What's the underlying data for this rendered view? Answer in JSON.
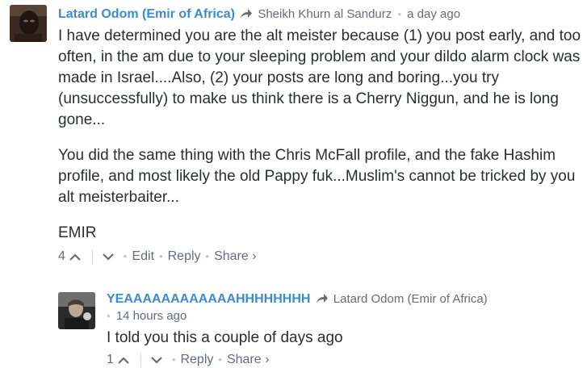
{
  "comments": [
    {
      "author": "Latard Odom (Emir of Africa)",
      "reply_to": "Sheikh Khurn al Sandurz",
      "separator": "•",
      "time": "a day ago",
      "paragraphs": [
        "I have determined you are the alt meister because (1) you post early, and too often, in the am due to your sleeping problem and your dildo alarm clock was made in Israel....Also, (2) your posts are long and boring...you try (unsuccessfully) to make us think there is a Cherry Niggun, and he is long gone...",
        "You did the same thing with the Chris McFall profile, and the fake Hashim profile, and most likely the old Pappy fuk...Muslim's cannot be tricked by you alt meisterbaiter...",
        "EMIR"
      ],
      "footer": {
        "votes": "4",
        "edit": "Edit",
        "reply": "Reply",
        "share": "Share ›",
        "dot": "•"
      }
    },
    {
      "author": "YEAAAAAAAAAAAAHHHHHHHH",
      "reply_to": "Latard Odom (Emir of Africa)",
      "separator": "•",
      "time": "14 hours ago",
      "paragraphs": [
        "I told you this a couple of days ago"
      ],
      "footer": {
        "votes": "1",
        "reply": "Reply",
        "share": "Share ›",
        "dot": "•"
      }
    }
  ]
}
